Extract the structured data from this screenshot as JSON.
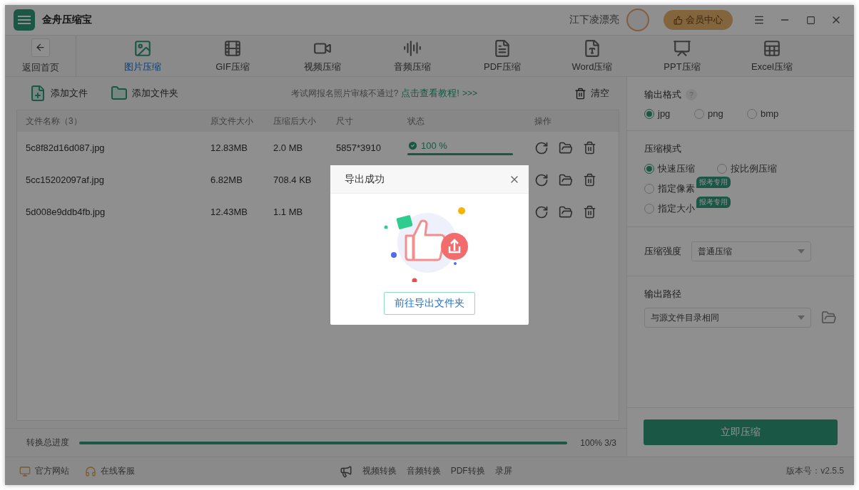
{
  "app": {
    "title": "金舟压缩宝",
    "user": "江下凌漂亮",
    "vip": "会员中心"
  },
  "nav": {
    "back": "返回首页",
    "tools": [
      {
        "kind": "image",
        "label": "图片压缩",
        "selected": true
      },
      {
        "kind": "gif",
        "label": "GIF压缩",
        "selected": false
      },
      {
        "kind": "video",
        "label": "视频压缩",
        "selected": false
      },
      {
        "kind": "audio",
        "label": "音频压缩",
        "selected": false
      },
      {
        "kind": "pdf",
        "label": "PDF压缩",
        "selected": false
      },
      {
        "kind": "word",
        "label": "Word压缩",
        "selected": false
      },
      {
        "kind": "ppt",
        "label": "PPT压缩",
        "selected": false
      },
      {
        "kind": "excel",
        "label": "Excel压缩",
        "selected": false
      }
    ]
  },
  "actions": {
    "add_file": "添加文件",
    "add_folder": "添加文件夹",
    "hint": "考试网报名照片审核不通过?",
    "hint_link": "点击查看教程!",
    "hint_arrows": ">>>",
    "clear": "清空"
  },
  "table": {
    "columns": [
      "文件名称（3）",
      "原文件大小",
      "压缩后大小",
      "尺寸",
      "状态",
      "操作"
    ],
    "rows": [
      {
        "name": "5c8f82d16d087.jpg",
        "original": "12.83MB",
        "compressed": "2.0 MB",
        "dimensions": "5857*3910",
        "status": "100 %",
        "level": 1
      },
      {
        "name": "5cc15202097af.jpg",
        "original": "6.82MB",
        "compressed": "708.4 KB"
      },
      {
        "name": "5d008e9ddb4fb.jpg",
        "original": "12.43MB",
        "compressed": "1.1 MB"
      }
    ]
  },
  "progress": {
    "label": "转换总进度",
    "level": 1,
    "reading": "100% 3/3"
  },
  "settings": {
    "format": {
      "label": "输出格式",
      "help": "?",
      "options": [
        {
          "label": "jpg",
          "selected": true
        },
        {
          "label": "png",
          "selected": false
        },
        {
          "label": "bmp",
          "selected": false
        }
      ]
    },
    "mode": {
      "label": "压缩模式",
      "options": [
        {
          "label": "快速压缩",
          "selected": true
        },
        {
          "label": "按比例压缩",
          "selected": false
        },
        {
          "label": "指定像素",
          "selected": false,
          "badge": "报考专用"
        },
        {
          "label": "指定大小",
          "selected": false,
          "badge": "报考专用"
        }
      ]
    },
    "strength": {
      "label": "压缩强度",
      "value": "普通压缩"
    },
    "path": {
      "label": "输出路径",
      "value": "与源文件目录相同"
    },
    "start": "立即压缩"
  },
  "footer": {
    "left": [
      "官方网站",
      "在线客服"
    ],
    "center": [
      "视频转换",
      "音频转换",
      "PDF转换",
      "录屏"
    ],
    "version": "版本号：v2.5.5"
  },
  "dialog": {
    "title": "导出成功",
    "button": "前往导出文件夹"
  }
}
